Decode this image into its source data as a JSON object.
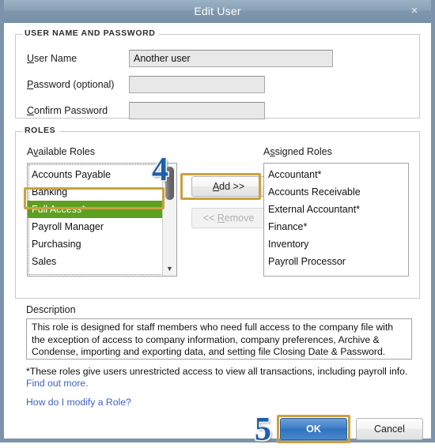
{
  "window": {
    "title": "Edit User",
    "close_icon": "close-icon",
    "close_glyph": "×"
  },
  "user_password_group": {
    "legend": "USER NAME AND PASSWORD",
    "fields": [
      {
        "label_prefix": "",
        "accel": "U",
        "label_suffix": "ser Name",
        "value": "Another user",
        "placeholder": ""
      },
      {
        "label_prefix": "",
        "accel": "P",
        "label_suffix": "assword (optional)",
        "value": "",
        "placeholder": ""
      },
      {
        "label_prefix": "",
        "accel": "C",
        "label_suffix": "onfirm Password",
        "value": "",
        "placeholder": ""
      }
    ]
  },
  "roles_group": {
    "legend": "ROLES",
    "available": {
      "label_prefix": "A",
      "accel": "v",
      "label_suffix": "ailable Roles",
      "items": [
        "Accounts Payable",
        "Banking",
        "Full Access*",
        "Payroll Manager",
        "Purchasing",
        "Sales"
      ],
      "selected_index": 2,
      "scroll_down_glyph": "▼"
    },
    "assigned": {
      "label_prefix": "A",
      "accel": "s",
      "label_suffix": "signed Roles",
      "items": [
        "Accountant*",
        "Accounts Receivable",
        "External Accountant*",
        "Finance*",
        "Inventory",
        "Payroll Processor"
      ]
    },
    "add_button": {
      "prefix": "",
      "accel": "A",
      "suffix": "dd >>",
      "enabled": true
    },
    "remove_button": {
      "prefix": "<< ",
      "accel": "R",
      "suffix": "emove",
      "enabled": false
    }
  },
  "description": {
    "label": "Description",
    "text": "This role is designed for staff members who need full access to the company file with the exception of access to company information, company preferences, Archive & Condense, importing and exporting data, and setting file Closing Date & Password."
  },
  "footnotes": {
    "asterisk_note": "*These roles give users unrestricted access to view all transactions, including payroll info.",
    "find_out_more": "Find out more.",
    "modify_role_link": "How do I modify a Role?"
  },
  "footer": {
    "ok_label": "OK",
    "cancel_label": "Cancel"
  },
  "annotations": {
    "step_add": "4",
    "step_ok": "5",
    "highlight_color": "#c9a23f",
    "number_color": "#1f5fa8",
    "selection_color": "#5d9f1f"
  }
}
